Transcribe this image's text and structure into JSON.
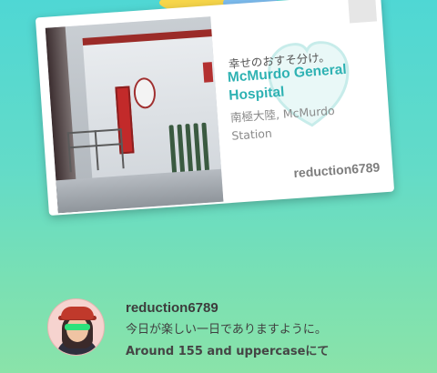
{
  "postcard": {
    "pretext": "幸せのおすそ分け。",
    "poi_name": "McMurdo General Hospital",
    "location": "南極大陸, McMurdo Station",
    "sender": "reduction6789"
  },
  "friend": {
    "username": "reduction6789",
    "message": "今日が楽しい一日でありますように。",
    "subtitle": "Around 155 and uppercaseにて"
  },
  "colors": {
    "background_top": "#4fd7d4",
    "background_bottom": "#8ae3a9",
    "poi_name": "#2fb2b3",
    "card": "#ffffff"
  },
  "icons": {
    "watermark": "heart-seal-icon",
    "avatar": "trainer-avatar"
  }
}
